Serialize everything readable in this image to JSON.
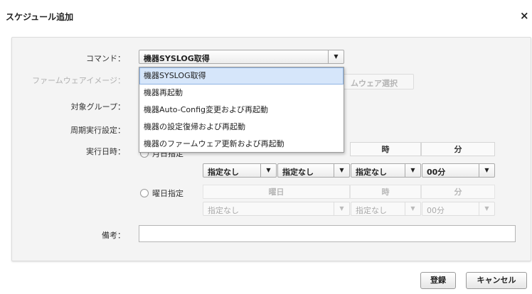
{
  "dialog": {
    "title": "スケジュール追加",
    "close_glyph": "×"
  },
  "form": {
    "command_label": "コマンド：",
    "firmware_label": "ファームウェアイメージ：",
    "target_group_label": "対象グループ：",
    "periodic_label": "周期実行設定：",
    "exec_date_label": "実行日時：",
    "memo_label": "備考：",
    "command_value": "機器SYSLOG取得",
    "firmware_button": "ムウェア選択"
  },
  "dropdown": {
    "options": [
      "機器SYSLOG取得",
      "機器再起動",
      "機器Auto-Config変更および再起動",
      "機器の設定復帰および再起動",
      "機器のファームウェア更新および再起動"
    ],
    "selected_index": 0
  },
  "schedule": {
    "month_day_label": "月日指定",
    "weekday_label": "曜日指定",
    "col_hour": "時",
    "col_minute": "分",
    "col_weekday": "曜日",
    "row1": {
      "v1": "指定なし",
      "v2": "指定なし",
      "v3": "指定なし",
      "v4": "00分"
    },
    "row2": {
      "weekday": "指定なし",
      "hour": "指定なし",
      "minute": "00分"
    }
  },
  "arrow_glyph": "▼",
  "footer": {
    "register": "登録",
    "cancel": "キャンセル"
  }
}
